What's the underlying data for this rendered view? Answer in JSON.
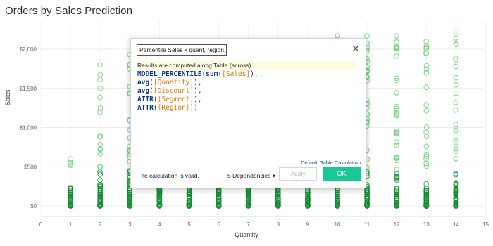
{
  "page": {
    "title": "Orders by Sales Prediction"
  },
  "chart_data": {
    "type": "scatter",
    "title": "Orders by Sales Prediction",
    "xlabel": "Quantity",
    "ylabel": "Sales",
    "x_ticks": [
      0,
      1,
      2,
      3,
      4,
      5,
      6,
      7,
      8,
      9,
      10,
      11,
      12,
      13,
      14,
      15
    ],
    "y_ticks": [
      "$0",
      "$500",
      "$1,000",
      "$1,500",
      "$2,000"
    ],
    "xlim": [
      0,
      15
    ],
    "ylim": [
      0,
      2150
    ],
    "grid": true,
    "marker_color": "#2e9e3a",
    "columns": [
      {
        "x": 1,
        "max": 600,
        "count": 24
      },
      {
        "x": 2,
        "max": 1800,
        "count": 38
      },
      {
        "x": 3,
        "max": 1930,
        "count": 46
      },
      {
        "x": 4,
        "max": 1900,
        "count": 46
      },
      {
        "x": 5,
        "max": 1900,
        "count": 46
      },
      {
        "x": 6,
        "max": 1900,
        "count": 46
      },
      {
        "x": 7,
        "max": 1900,
        "count": 46
      },
      {
        "x": 8,
        "max": 1900,
        "count": 46
      },
      {
        "x": 9,
        "max": 1900,
        "count": 46
      },
      {
        "x": 10,
        "max": 2170,
        "count": 48
      },
      {
        "x": 11,
        "max": 2170,
        "count": 48
      },
      {
        "x": 12,
        "max": 2170,
        "count": 48
      },
      {
        "x": 13,
        "max": 2100,
        "count": 46
      },
      {
        "x": 14,
        "max": 2220,
        "count": 46
      }
    ]
  },
  "dialog": {
    "name": "Percentile Sales x quant, region,seg",
    "note": "Results are computed along Table (across).",
    "code": {
      "fn1": "MODEL_PERCENTILE",
      "fn2": "sum",
      "field_sales": "[Sales]",
      "avg1": "avg",
      "field_qty": "[Quantity]",
      "avg2": "avg",
      "field_disc": "[Discount]",
      "attr1": "ATTR",
      "field_seg": "[Segment]",
      "attr2": "ATTR",
      "field_region": "[Region]"
    },
    "default_link": "Default: Table Calculation",
    "status": "The calculation is valid.",
    "dependencies": "5 Dependencies ▾",
    "apply_label": "Apply",
    "ok_label": "OK",
    "close_icon": "close-icon"
  }
}
